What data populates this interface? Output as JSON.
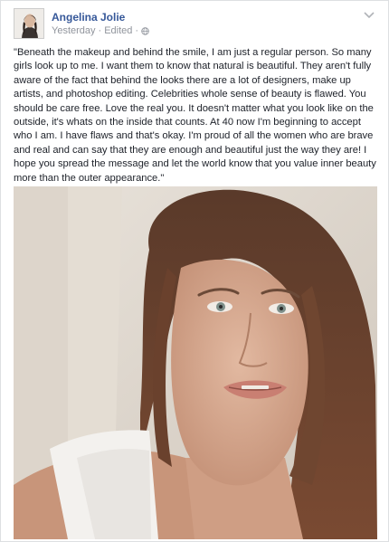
{
  "post": {
    "author": "Angelina Jolie",
    "time": "Yesterday",
    "edited": "Edited",
    "separator": "·",
    "message": "\"Beneath the makeup and behind the smile, I am just a regular person. So many girls look up to me. I want them to know that natural is beautiful. They aren't fully aware of the fact that behind the looks there are a lot of designers, make up artists, and photoshop editing. Celebrities whole sense of beauty is flawed. You should be care free. Love the real you. It doesn't matter what you look like on the outside, it's whats on the inside that counts. At 40 now I'm beginning to accept who I am. I have flaws and that's okay. I'm proud of all the women who are brave and real and can say that they are enough and beautiful just the way they are! I hope you spread the message and let the world know that you value inner beauty more than the outer appearance.\""
  },
  "icons": {
    "globe": "globe-icon",
    "chevron": "chevron-down-icon"
  },
  "colors": {
    "author_link": "#365899",
    "meta_text": "#90949c",
    "body_text": "#1d2129",
    "border": "#dddfe2"
  }
}
